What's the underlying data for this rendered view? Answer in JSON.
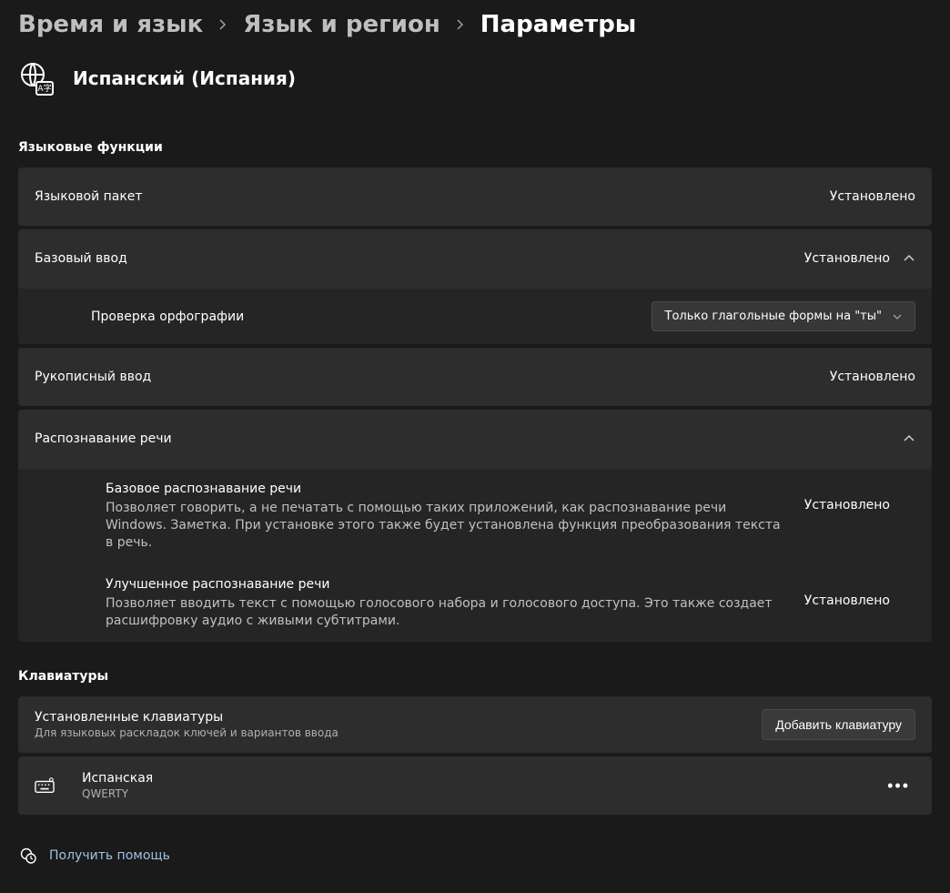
{
  "breadcrumb": {
    "item1": "Время и язык",
    "item2": "Язык и регион",
    "item3": "Параметры"
  },
  "language": {
    "title": "Испанский (Испания)"
  },
  "sections": {
    "features": {
      "title": "Языковые функции",
      "langPack": {
        "label": "Языковой пакет",
        "status": "Установлено"
      },
      "basicTyping": {
        "label": "Базовый ввод",
        "status": "Установлено"
      },
      "spellCheck": {
        "label": "Проверка орфографии",
        "dropdown": "Только глагольные формы на \"ты\""
      },
      "handwriting": {
        "label": "Рукописный ввод",
        "status": "Установлено"
      },
      "speech": {
        "label": "Распознавание речи",
        "basic": {
          "title": "Базовое распознавание речи",
          "desc": "Позволяет говорить, а не печатать с помощью таких приложений, как распознавание речи Windows. Заметка. При установке этого также будет установлена функция преобразования текста в речь.",
          "status": "Установлено"
        },
        "enhanced": {
          "title": "Улучшенное распознавание речи",
          "desc": "Позволяет вводить текст с помощью голосового набора и голосового доступа. Это также создает расшифровку аудио с живыми субтитрами.",
          "status": "Установлено"
        }
      }
    },
    "keyboards": {
      "title": "Клавиатуры",
      "installed": {
        "title": "Установленные клавиатуры",
        "sub": "Для языковых раскладок ключей и вариантов ввода",
        "addBtn": "Добавить клавиатуру"
      },
      "item": {
        "name": "Испанская",
        "layout": "QWERTY"
      }
    }
  },
  "help": {
    "label": "Получить помощь"
  }
}
